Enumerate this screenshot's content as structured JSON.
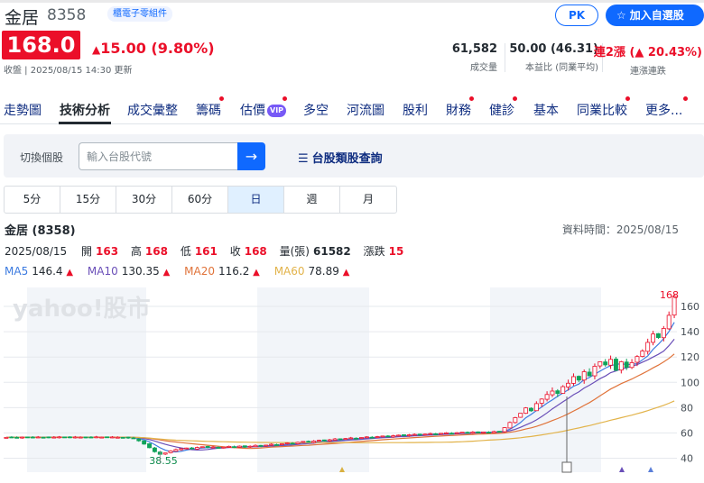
{
  "stock": {
    "name": "金居",
    "code": "8358",
    "industry_tag": "櫃電子零組件",
    "price": "168.0",
    "change": "15.00 (9.80%)",
    "updated": "收盤 | 2025/08/15 14:30 更新"
  },
  "buttons": {
    "pk": "PK",
    "add": "加入自選股"
  },
  "stats": [
    {
      "value": "61,582",
      "label": "成交量"
    },
    {
      "value": "50.00 (46.31)",
      "label": "本益比 (同業平均)"
    },
    {
      "value": "連2漲 (▲ 20.43%)",
      "label": "連漲連跌"
    }
  ],
  "nav": [
    "走勢圖",
    "技術分析",
    "成交彙整",
    "籌碼",
    "估價",
    "多空",
    "河流圖",
    "股利",
    "財務",
    "健診",
    "基本",
    "同業比較",
    "更多..."
  ],
  "nav_vip": "VIP",
  "search": {
    "label": "切換個股",
    "placeholder": "輸入台股代號",
    "category_link": "台股類股查詢"
  },
  "periods": [
    "5分",
    "15分",
    "30分",
    "60分",
    "日",
    "週",
    "月"
  ],
  "chart_header": {
    "title": "金居 (8358)",
    "data_time": "資料時間：2025/08/15",
    "date": "2025/08/15",
    "open_label": "開",
    "open": "163",
    "high_label": "高",
    "high": "168",
    "low_label": "低",
    "low": "161",
    "close_label": "收",
    "close": "168",
    "volume_label": "量(張)",
    "volume": "61582",
    "change_label": "漲跌",
    "change": "15"
  },
  "ma": [
    {
      "name": "MA5",
      "value": "146.4",
      "color": "#3c7be0"
    },
    {
      "name": "MA10",
      "value": "130.35",
      "color": "#6a4fb8"
    },
    {
      "name": "MA20",
      "value": "116.2",
      "color": "#e0733a"
    },
    {
      "name": "MA60",
      "value": "78.89",
      "color": "#e2b34a"
    }
  ],
  "colors": {
    "up": "#eb0f29",
    "down": "#0fa35a",
    "accent": "#0f69ff"
  },
  "chart_data": {
    "type": "candlestick",
    "watermark": "yahoo!股市",
    "y_ticks": [
      40,
      60,
      80,
      100,
      120,
      140,
      160
    ],
    "ylim": [
      29,
      175
    ],
    "high_label": "168",
    "low_label": "38.55",
    "closes": [
      56.5,
      56.6,
      56.4,
      56.7,
      56.5,
      56.6,
      56.8,
      56.6,
      56.5,
      56.7,
      56.9,
      56.6,
      56.4,
      56.8,
      56.7,
      56.5,
      56.6,
      56.9,
      56.7,
      56.5,
      56.8,
      56.6,
      56.4,
      56.1,
      55.5,
      53.8,
      51.2,
      48.3,
      45.2,
      43.1,
      44.2,
      45.8,
      46.9,
      47.6,
      48.1,
      47.6,
      48.5,
      49.1,
      48.6,
      48.9,
      48.2,
      48.8,
      49.4,
      48.9,
      49.6,
      48.8,
      49.5,
      50.2,
      49.6,
      50.4,
      51.1,
      50.6,
      51.4,
      52.1,
      51.7,
      52.6,
      53.3,
      52.8,
      53.6,
      54.2,
      53.8,
      54.6,
      55.3,
      54.9,
      55.6,
      56.1,
      55.7,
      56.4,
      56.9,
      56.5,
      57.1,
      57.6,
      57.2,
      57.8,
      58.3,
      57.9,
      58.5,
      58.9,
      58.4,
      59.1,
      59.5,
      59.1,
      59.7,
      60.1,
      59.6,
      60.2,
      60.6,
      60.1,
      60.7,
      60.3,
      60.8,
      60.4,
      61.1,
      60.9,
      64.2,
      68.3,
      72.1,
      75.6,
      79.8,
      77.5,
      83.2,
      86.8,
      90.4,
      93.1,
      91.2,
      96.6,
      99.3,
      104.5,
      101.8,
      108.4,
      105.1,
      112.7,
      116.3,
      113.8,
      118.2,
      109.5,
      116.3,
      111.9,
      115.6,
      120.4,
      124.8,
      131.6,
      138.2,
      135.4,
      142.6,
      153.0,
      168.0
    ]
  }
}
